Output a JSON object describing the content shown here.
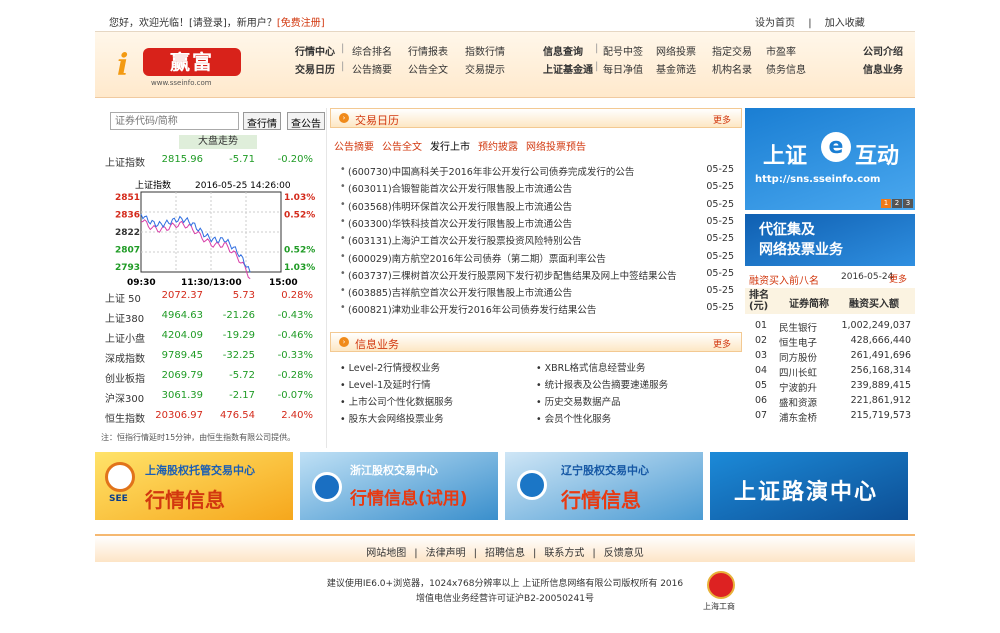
{
  "topbar": {
    "greeting": "您好，欢迎光临！[请登录]，新用户？",
    "register": "[免费注册]",
    "set_home": "设为首页",
    "bookmark": "加入收藏"
  },
  "logo": {
    "brand": "赢富",
    "url": "www.sseinfo.com"
  },
  "nav": {
    "row1": [
      "行情中心",
      "综合排名",
      "行情报表",
      "指数行情",
      "信息查询",
      "配号中签",
      "网络投票",
      "指定交易",
      "市盈率",
      "公司介绍"
    ],
    "row2": [
      "交易日历",
      "公告摘要",
      "公告全文",
      "交易提示",
      "上证基金通",
      "每日净值",
      "基金筛选",
      "机构名录",
      "债务信息",
      "信息业务"
    ]
  },
  "search": {
    "placeholder": "证券代码/简称",
    "btn_quote": "查行情",
    "btn_notice": "查公告"
  },
  "market": {
    "title": "大盘走势",
    "top_index": {
      "name": "上证指数",
      "v1": "2815.96",
      "v2": "-5.71",
      "v3": "-0.20%"
    },
    "chart": {
      "name": "上证指数",
      "datetime": "2016-05-25 14:26:00",
      "y_labels_left": [
        "2851",
        "2836",
        "2822",
        "2807",
        "2793"
      ],
      "y_labels_right": [
        "1.03%",
        "0.52%",
        "",
        "0.52%",
        "1.03%"
      ],
      "x_labels": [
        "09:30",
        "11:30/13:00",
        "15:00"
      ]
    },
    "indices": [
      {
        "name": "上证 50",
        "v1": "2072.37",
        "v2": "5.73",
        "v3": "0.28%",
        "dir": "up"
      },
      {
        "name": "上证380",
        "v1": "4964.63",
        "v2": "-21.26",
        "v3": "-0.43%",
        "dir": "down"
      },
      {
        "name": "上证小盘",
        "v1": "4204.09",
        "v2": "-19.29",
        "v3": "-0.46%",
        "dir": "down"
      },
      {
        "name": "深成指数",
        "v1": "9789.45",
        "v2": "-32.25",
        "v3": "-0.33%",
        "dir": "down"
      },
      {
        "name": "创业板指",
        "v1": "2069.79",
        "v2": "-5.72",
        "v3": "-0.28%",
        "dir": "down"
      },
      {
        "name": "沪深300",
        "v1": "3061.39",
        "v2": "-2.17",
        "v3": "-0.07%",
        "dir": "down"
      },
      {
        "name": "恒生指数",
        "v1": "20306.97",
        "v2": "476.54",
        "v3": "2.40%",
        "dir": "up"
      }
    ],
    "note": "注：恒指行情延时15分钟，由恒生指数有限公司提供。"
  },
  "calendar": {
    "title": "交易日历",
    "more": "更多",
    "tabs": [
      "公告摘要",
      "公告全文",
      "发行上市",
      "预约披露",
      "网络投票预告"
    ],
    "news": [
      {
        "text": "(600730)中国高科关于2016年非公开发行公司债券完成发行的公告",
        "date": "05-25"
      },
      {
        "text": "(603011)合锻智能首次公开发行限售股上市流通公告",
        "date": "05-25"
      },
      {
        "text": "(603568)伟明环保首次公开发行限售股上市流通公告",
        "date": "05-25"
      },
      {
        "text": "(603300)华铁科技首次公开发行限售股上市流通公告",
        "date": "05-25"
      },
      {
        "text": "(603131)上海沪工首次公开发行股票投资风险特别公告",
        "date": "05-25"
      },
      {
        "text": "(600029)南方航空2016年公司债券（第二期）票面利率公告",
        "date": "05-25"
      },
      {
        "text": "(603737)三棵树首次公开发行股票网下发行初步配售结果及网上中签结果公告",
        "date": "05-25"
      },
      {
        "text": "(603885)吉祥航空首次公开发行限售股上市流通公告",
        "date": "05-25"
      },
      {
        "text": "(600821)津劝业非公开发行2016年公司债券发行结果公告",
        "date": "05-25"
      }
    ]
  },
  "infobiz": {
    "title": "信息业务",
    "more": "更多",
    "items": [
      "Level-2行情授权业务",
      "XBRL格式信息经营业务",
      "Level-1及延时行情",
      "统计报表及公告摘要速递服务",
      "上市公司个性化数据服务",
      "历史交易数据产品",
      "股东大会网络投票业务",
      "会员个性化服务"
    ]
  },
  "right": {
    "banner1_title": "上证",
    "banner1_e": "e",
    "banner1_title2": "互动",
    "banner1_url": "http://sns.sseinfo.com",
    "pages": [
      "1",
      "2",
      "3"
    ],
    "banner2_line1": "代征集及",
    "banner2_line2": "网络投票业务",
    "rz_title": "融资买入前八名",
    "rz_date": "2016-05-24",
    "rz_more": "更多",
    "rz_head": [
      "排名(元)",
      "证券简称",
      "融资买入额"
    ],
    "rz_rows": [
      {
        "rank": "01",
        "name": "民生银行",
        "amt": "1,002,249,037"
      },
      {
        "rank": "02",
        "name": "恒生电子",
        "amt": "428,666,440"
      },
      {
        "rank": "03",
        "name": "同方股份",
        "amt": "261,491,696"
      },
      {
        "rank": "04",
        "name": "四川长虹",
        "amt": "256,168,314"
      },
      {
        "rank": "05",
        "name": "宁波韵升",
        "amt": "239,889,415"
      },
      {
        "rank": "06",
        "name": "盛和资源",
        "amt": "221,861,912"
      },
      {
        "rank": "07",
        "name": "浦东金桥",
        "amt": "215,719,573"
      }
    ]
  },
  "banners": [
    {
      "t1": "上海股权托管交易中心",
      "t2": "行情信息",
      "logo": "SEE"
    },
    {
      "t1": "浙江股权交易中心",
      "t2": "行情信息(试用)"
    },
    {
      "t1": "辽宁股权交易中心",
      "t2": "行情信息"
    },
    {
      "t2": "上证路演中心"
    }
  ],
  "footer": {
    "links": [
      "网站地图",
      "法律声明",
      "招聘信息",
      "联系方式",
      "反馈意见"
    ],
    "copy1": "建议使用IE6.0+浏览器，1024x768分辨率以上 上证所信息网络有限公司版权所有 2016",
    "copy2": "增值电信业务经营许可证沪B2-20050241号",
    "badge_label": "上海工商"
  },
  "colors": {
    "accent": "#d2380f",
    "up": "#d42a1b",
    "down": "#1f9b25",
    "header_bg": "#ffe9cc"
  }
}
